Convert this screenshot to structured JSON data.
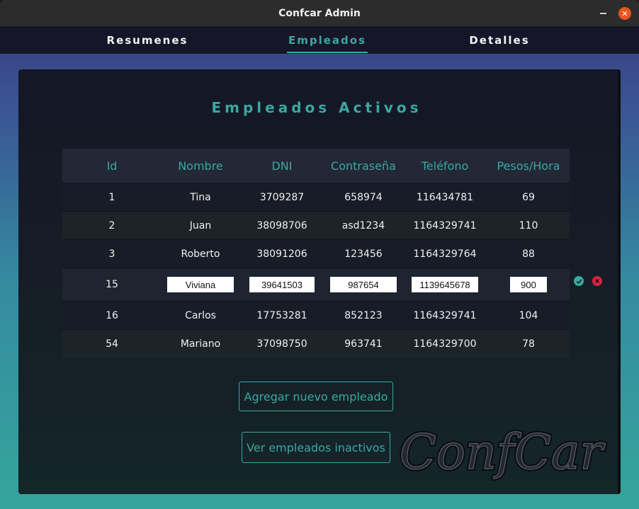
{
  "window": {
    "title": "Confcar Admin"
  },
  "nav": {
    "tabs": [
      {
        "label": "Resumenes"
      },
      {
        "label": "Empleados"
      },
      {
        "label": "Detalles"
      }
    ]
  },
  "page": {
    "title": "Empleados Activos"
  },
  "table": {
    "headers": [
      "Id",
      "Nombre",
      "DNI",
      "Contraseña",
      "Teléfono",
      "Pesos/Hora"
    ],
    "rows": [
      {
        "id": "1",
        "nombre": "Tina",
        "dni": "3709287",
        "pass": "658974",
        "tel": "116434781",
        "pesos": "69"
      },
      {
        "id": "2",
        "nombre": "Juan",
        "dni": "38098706",
        "pass": "asd1234",
        "tel": "1164329741",
        "pesos": "110"
      },
      {
        "id": "3",
        "nombre": "Roberto",
        "dni": "38091206",
        "pass": "123456",
        "tel": "1164329764",
        "pesos": "88"
      },
      {
        "id": "15",
        "nombre": "Viviana",
        "dni": "39641503",
        "pass": "987654",
        "tel": "1139645678",
        "pesos": "900"
      },
      {
        "id": "16",
        "nombre": "Carlos",
        "dni": "17753281",
        "pass": "852123",
        "tel": "1164329741",
        "pesos": "104"
      },
      {
        "id": "54",
        "nombre": "Mariano",
        "dni": "37098750",
        "pass": "963741",
        "tel": "1164329700",
        "pesos": "78"
      }
    ]
  },
  "buttons": {
    "add_label": "Agregar nuevo empleado",
    "inactive_label": "Ver empleados inactivos"
  },
  "logo": {
    "text": "ConfCar"
  },
  "colors": {
    "accent": "#3aa8a0",
    "cancel": "#d4253f",
    "window_close": "#e95420"
  }
}
